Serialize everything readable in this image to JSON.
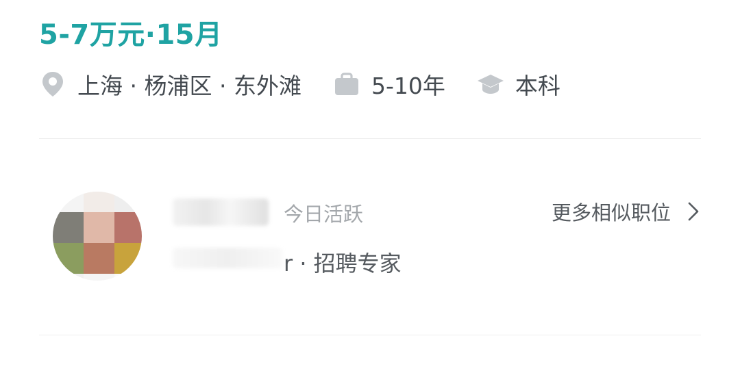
{
  "job": {
    "salary": "5-7万元·15月",
    "location": "上海 · 杨浦区 · 东外滩",
    "experience": "5-10年",
    "education": "本科",
    "icons": {
      "location": "location-pin-icon",
      "experience": "briefcase-icon",
      "education": "graduation-cap-icon"
    }
  },
  "recruiter": {
    "status": "今日活跃",
    "role": "r · 招聘专家",
    "more_label": "更多相似职位",
    "more_icon": "chevron-right-icon"
  },
  "colors": {
    "salary": "#1fa3a3",
    "icon_gray": "#c4c8cc",
    "text_primary": "#444a50",
    "text_muted": "#a3a7ab"
  }
}
